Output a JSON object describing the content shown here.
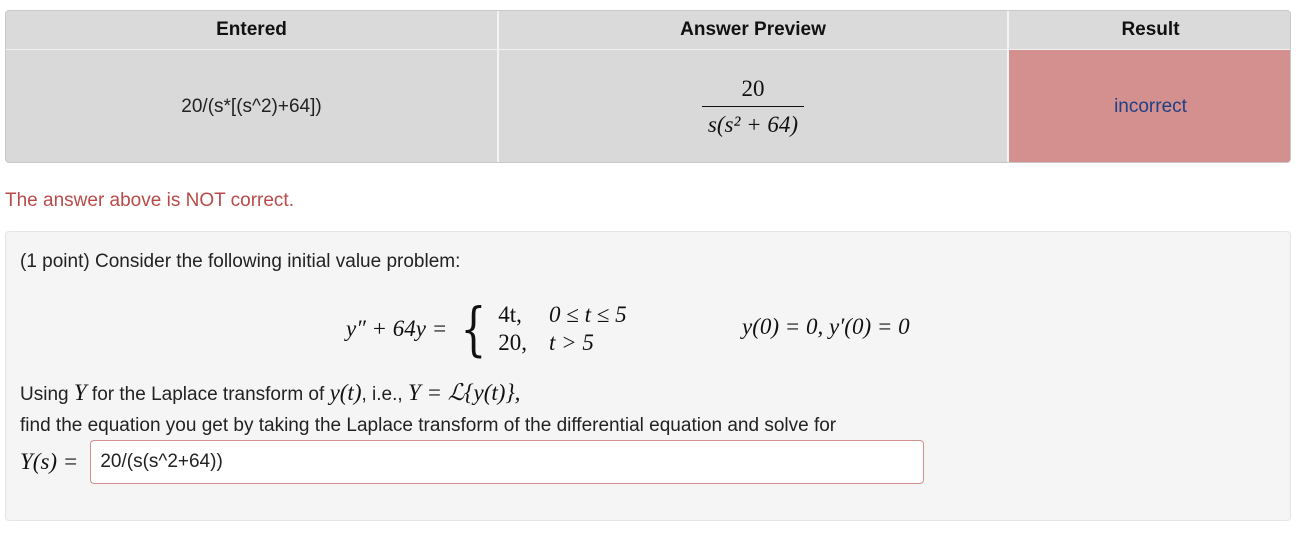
{
  "table": {
    "headers": [
      "Entered",
      "Answer Preview",
      "Result"
    ],
    "entered": "20/(s*[(s^2)+64])",
    "preview_numerator": "20",
    "preview_denominator": "s(s² + 64)",
    "result": "incorrect"
  },
  "feedback": "The answer above is NOT correct.",
  "problem": {
    "intro": "(1 point) Consider the following initial value problem:",
    "ode_lhs": "y″ + 64y =",
    "cases": [
      {
        "value": "4t,",
        "condition": "0 ≤ t ≤ 5"
      },
      {
        "value": "20,",
        "condition": "t > 5"
      }
    ],
    "initial_conditions": "y(0) = 0,  y′(0) = 0",
    "line1_before": "Using ",
    "line1_Y": "Y",
    "line1_mid": " for the Laplace transform of ",
    "line1_yt": "y(t)",
    "line1_after": ", i.e., ",
    "line1_transform": "Y = ℒ{y(t)},",
    "line2": "find the equation you get by taking the Laplace transform of the differential equation and solve for",
    "answer_label": "Y(s) =",
    "answer_value": "20/(s(s^2+64))"
  },
  "colors": {
    "incorrect_bg": "#d4908f",
    "incorrect_text": "#1f3f86",
    "feedback_text": "#b94a48"
  }
}
